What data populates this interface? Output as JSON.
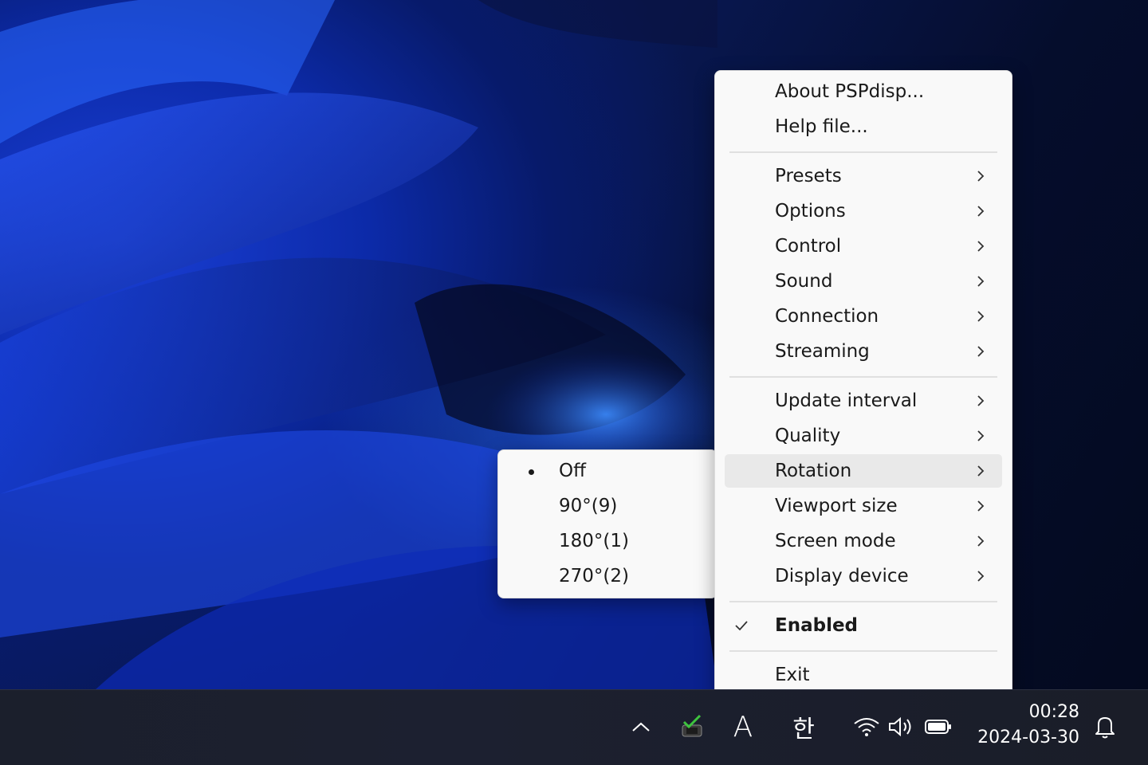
{
  "main_menu": {
    "items": [
      {
        "label": "About PSPdisp..."
      },
      {
        "label": "Help file..."
      },
      {
        "label": "Presets"
      },
      {
        "label": "Options"
      },
      {
        "label": "Control"
      },
      {
        "label": "Sound"
      },
      {
        "label": "Connection"
      },
      {
        "label": "Streaming"
      },
      {
        "label": "Update interval"
      },
      {
        "label": "Quality"
      },
      {
        "label": "Rotation",
        "highlighted": true
      },
      {
        "label": "Viewport size"
      },
      {
        "label": "Screen mode"
      },
      {
        "label": "Display device"
      },
      {
        "label": "Enabled",
        "checked": true,
        "bold": true
      },
      {
        "label": "Exit"
      }
    ]
  },
  "rotation_submenu": {
    "items": [
      {
        "label": "Off",
        "selected": true
      },
      {
        "label": "90°(9)"
      },
      {
        "label": "180°(1)"
      },
      {
        "label": "270°(2)"
      }
    ]
  },
  "taskbar": {
    "ime_language": "A",
    "ime_hangul": "한",
    "clock_time": "00:28",
    "clock_date": "2024-03-30",
    "icons": [
      "chevron-up-icon",
      "pspdisp-tray-icon",
      "ime-mode-icon",
      "hangul-icon",
      "wifi-icon",
      "volume-icon",
      "battery-icon",
      "notification-bell-icon"
    ]
  },
  "colors": {
    "menu_bg": "#f9f9f9",
    "menu_highlight": "#e9e9e9",
    "taskbar_bg": "#1c2030",
    "wallpaper_accent": "#1a3fd6"
  }
}
